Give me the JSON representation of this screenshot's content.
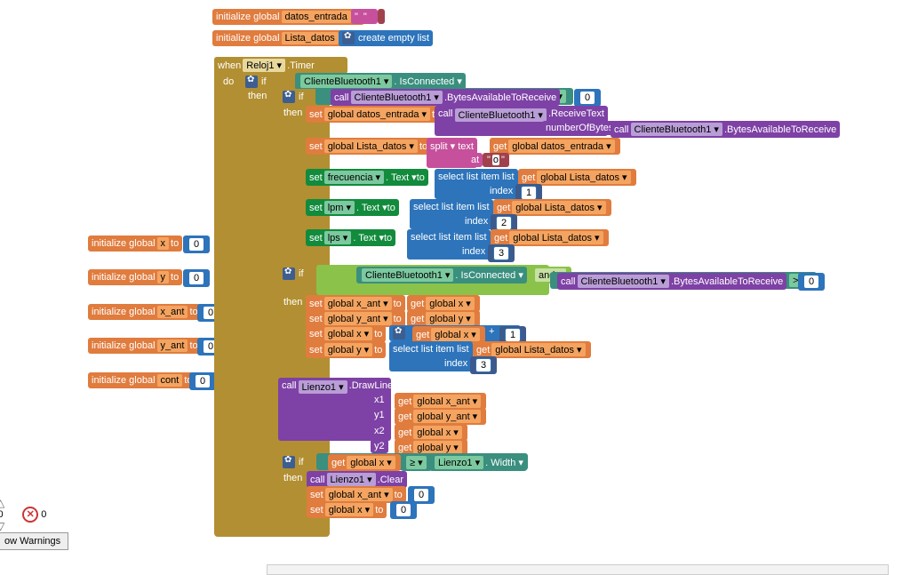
{
  "init": {
    "prefix": "initialize global",
    "to": "to",
    "datos_entrada": "datos_entrada",
    "lista_datos": "Lista_datos",
    "x": "x",
    "y": "y",
    "x_ant": "x_ant",
    "y_ant": "y_ant",
    "cont": "cont",
    "zero": "0",
    "create_empty_list": "create empty list"
  },
  "when": {
    "label": "when",
    "component": "Reloj1 ▾",
    "event": ".Timer",
    "do": "do"
  },
  "if": "if",
  "then": "then",
  "call": "call",
  "bt": {
    "component": "ClienteBluetooth1 ▾",
    "isConnected": ".  IsConnected ▾",
    "bytesAvail": ".BytesAvailableToReceive",
    "receiveText": ".ReceiveText",
    "numberOfBytes": "numberOfBytes"
  },
  "gt": "> ▾",
  "ge": "≥ ▾",
  "and": "and ▾",
  "plus": "+",
  "set": "set",
  "get": "get",
  "global_datos_entrada": "global datos_entrada ▾",
  "global_lista_datos": "global Lista_datos ▾",
  "global_x": "global x ▾",
  "global_y": "global y ▾",
  "global_x_ant": "global x_ant ▾",
  "global_y_ant": "global y_ant ▾",
  "split_text": "split ▾   text",
  "at": "at",
  "frecuencia": "frecuencia ▾",
  "lpm": "lpm ▾",
  "lps": "lps ▾",
  "text_prop": ".  Text ▾",
  "select_list_item_list": "select list item  list",
  "index": "index",
  "n1": "1",
  "n2": "2",
  "n3": "3",
  "lienzo": {
    "component": "Lienzo1 ▾",
    "drawLine": ".DrawLine",
    "clear": ".Clear",
    "width": ".  Width ▾"
  },
  "x1": "x1",
  "y1": "y1",
  "x2": "x2",
  "y2": "y2",
  "ui": {
    "zero": "0",
    "warnings": "ow Warnings"
  }
}
